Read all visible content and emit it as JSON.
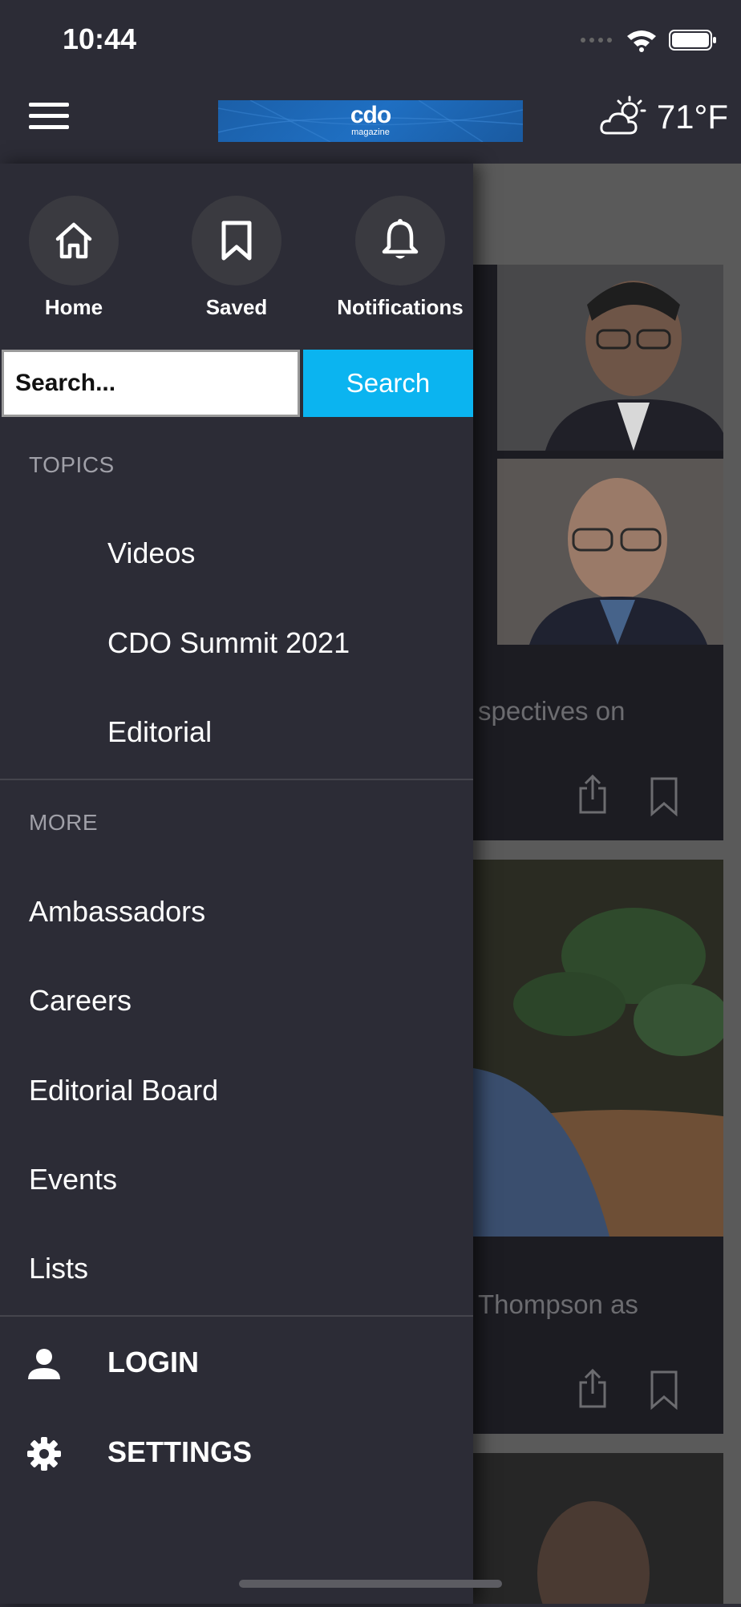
{
  "status_bar": {
    "time": "10:44"
  },
  "header": {
    "logo_main": "cdo",
    "logo_sub": "magazine",
    "temperature": "71°F",
    "weather_icon": "partly-cloudy-icon"
  },
  "drawer": {
    "quick_actions": [
      {
        "label": "Home",
        "icon": "home-icon"
      },
      {
        "label": "Saved",
        "icon": "bookmark-icon"
      },
      {
        "label": "Notifications",
        "icon": "bell-icon"
      }
    ],
    "search": {
      "placeholder": "Search...",
      "button_label": "Search"
    },
    "topics": {
      "header": "TOPICS",
      "items": [
        "Videos",
        "CDO Summit 2021",
        "Editorial"
      ]
    },
    "more": {
      "header": "MORE",
      "items": [
        "Ambassadors",
        "Careers",
        "Editorial Board",
        "Events",
        "Lists"
      ]
    },
    "footer": {
      "login_label": "LOGIN",
      "settings_label": "SETTINGS"
    }
  },
  "background_feed": {
    "card1_text": "spectives on",
    "card2_text": "Thompson as"
  },
  "colors": {
    "drawer_bg": "#2c2c36",
    "search_button": "#0bb4f0",
    "logo_blue": "#1f6fc2"
  }
}
